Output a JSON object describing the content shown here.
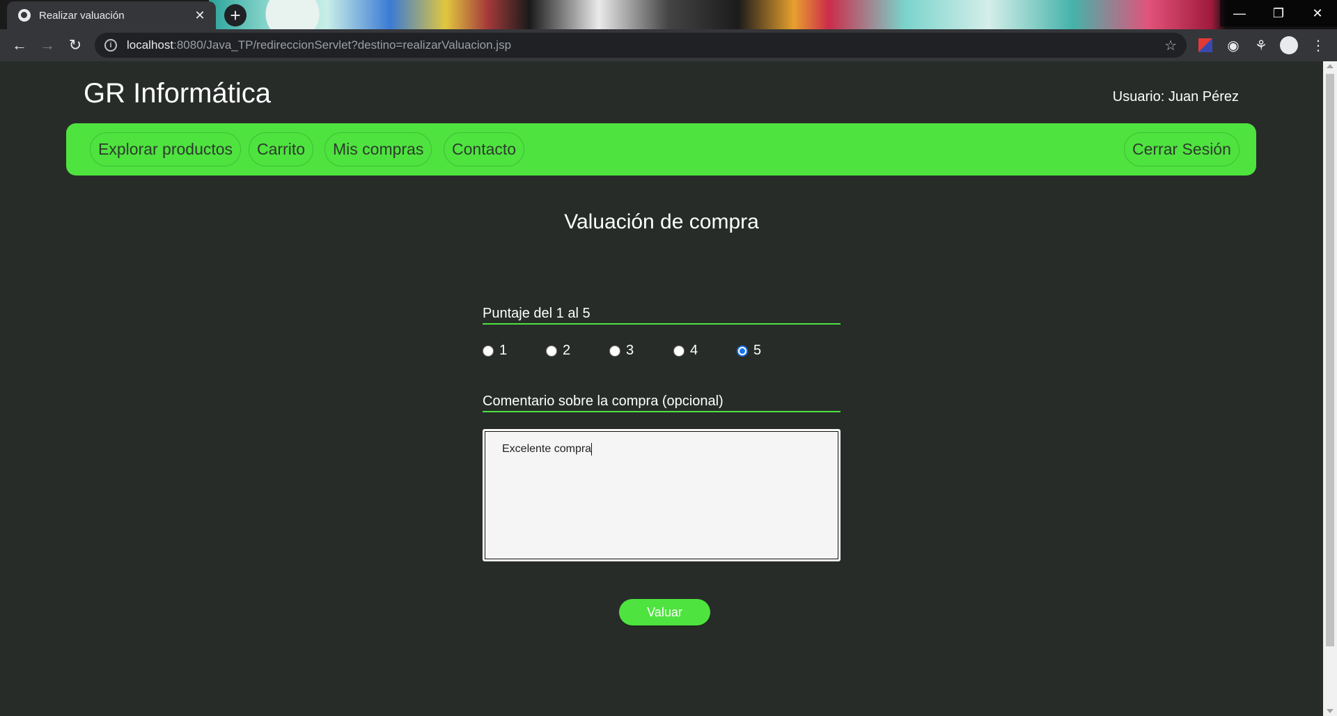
{
  "browser": {
    "tab_title": "Realizar valuación",
    "url_host": "localhost",
    "url_path": ":8080/Java_TP/redireccionServlet?destino=realizarValuacion.jsp",
    "new_tab": "+",
    "close": "✕"
  },
  "header": {
    "brand": "GR Informática",
    "user": "Usuario: Juan Pérez"
  },
  "nav": {
    "links": [
      "Explorar productos",
      "Carrito",
      "Mis compras",
      "Contacto"
    ],
    "logout": "Cerrar Sesión"
  },
  "main": {
    "title": "Valuación de compra",
    "score_label": "Puntaje del 1 al 5",
    "score_options": [
      "1",
      "2",
      "3",
      "4",
      "5"
    ],
    "score_selected": "5",
    "comment_label": "Comentario sobre la compra (opcional)",
    "comment_value": "Excelente compra",
    "submit": "Valuar"
  },
  "colors": {
    "accent": "#4ee33f",
    "background": "#272c29"
  }
}
